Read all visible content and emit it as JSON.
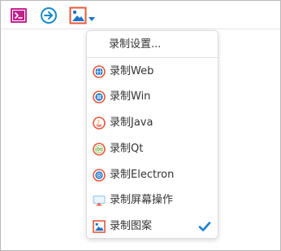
{
  "toolbar": {
    "buttons": [
      {
        "name": "terminal",
        "icon": "terminal-icon",
        "color": "#c2228c"
      },
      {
        "name": "navigate",
        "icon": "arrow-right-circle-icon",
        "color": "#1a8ac9"
      },
      {
        "name": "image",
        "icon": "image-icon",
        "color": "#e8573a"
      }
    ]
  },
  "menu": {
    "header_label": "录制设置...",
    "items": [
      {
        "label": "录制Web",
        "icon": "globe-icon"
      },
      {
        "label": "录制Win",
        "icon": "windows-icon"
      },
      {
        "label": "录制Java",
        "icon": "java-icon"
      },
      {
        "label": "录制Qt",
        "icon": "qt-icon"
      },
      {
        "label": "录制Electron",
        "icon": "electron-icon"
      },
      {
        "label": "录制屏幕操作",
        "icon": "monitor-icon"
      },
      {
        "label": "录制图案",
        "icon": "image-icon",
        "checked": true
      }
    ]
  },
  "colors": {
    "accent_orange": "#e8573a",
    "accent_blue": "#1a73c9",
    "terminal_magenta": "#c2228c",
    "check_blue": "#1a7fd4"
  }
}
